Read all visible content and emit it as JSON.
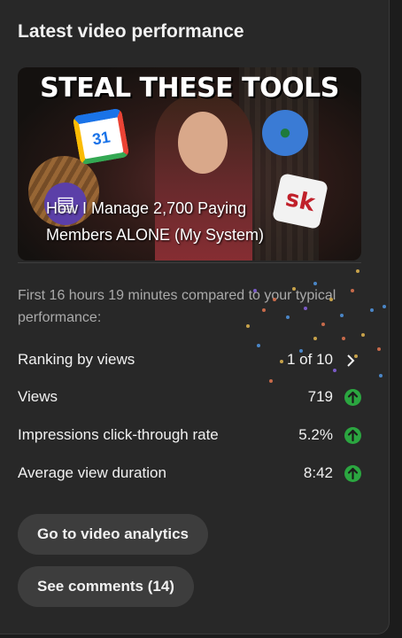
{
  "card": {
    "title": "Latest video performance"
  },
  "video": {
    "thumbnail_headline": "STEAL THESE TOOLS",
    "title_line1": "How I Manage 2,700 Paying",
    "title_line2": "Members ALONE (My System)",
    "calendar_icon_text": "31",
    "sk_icon_text": "sk"
  },
  "performance": {
    "subtitle": "First 16 hours 19 minutes compared to your typical performance:",
    "rows": [
      {
        "label": "Ranking by views",
        "value": "1 of 10",
        "indicator": "chevron-right-icon"
      },
      {
        "label": "Views",
        "value": "719",
        "indicator": "trend-up-icon"
      },
      {
        "label": "Impressions click-through rate",
        "value": "5.2%",
        "indicator": "trend-up-icon"
      },
      {
        "label": "Average view duration",
        "value": "8:42",
        "indicator": "trend-up-icon"
      }
    ]
  },
  "actions": {
    "analytics_label": "Go to video analytics",
    "comments_label": "See comments (14)"
  },
  "colors": {
    "background": "#282828",
    "text": "#f1f1f1",
    "muted_text": "#aaaaaa",
    "button_bg": "#3d3d3d",
    "trend_up": "#2ba640"
  }
}
